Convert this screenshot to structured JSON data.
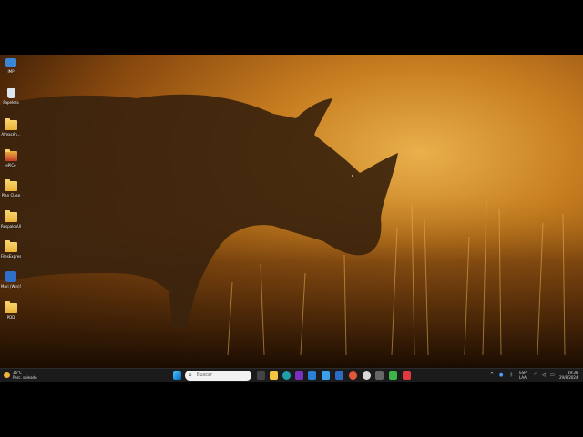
{
  "desktop": {
    "icons": [
      {
        "label": "IMP",
        "icon": "pc-icon"
      },
      {
        "label": "Papelera",
        "icon": "recycle-bin-icon"
      },
      {
        "label": "Almacén...",
        "icon": "folder-icon"
      },
      {
        "label": "ePiCe",
        "icon": "folder-icon"
      },
      {
        "label": "Plan Clase",
        "icon": "folder-icon"
      },
      {
        "label": "RespaldoUIB",
        "icon": "folder-icon"
      },
      {
        "label": "FilesExpress",
        "icon": "folder-icon"
      },
      {
        "label": "Mari (Win)Sinc...",
        "icon": "app-icon"
      },
      {
        "label": "PDD",
        "icon": "folder-icon"
      }
    ]
  },
  "taskbar": {
    "weather": {
      "temp": "36°C",
      "desc": "Parc. soleado"
    },
    "search_placeholder": "Buscar",
    "apps": [
      "windows-icon",
      "task-view-icon",
      "file-explorer-icon",
      "edge-icon",
      "chrome-icon",
      "visual-studio-icon",
      "vscode-icon",
      "app-icon",
      "app-icon",
      "app-icon",
      "terminal-icon",
      "app-icon",
      "app-icon",
      "app-icon"
    ],
    "tray": {
      "lang": "ESP",
      "region": "LAA",
      "time": "19:38",
      "date": "29/8/2024"
    }
  },
  "colors": {
    "sky_light": "#e9b04c",
    "sky_dark": "#1c0d03",
    "taskbar": "#1b1b1b",
    "folder": "#f7d36a"
  }
}
